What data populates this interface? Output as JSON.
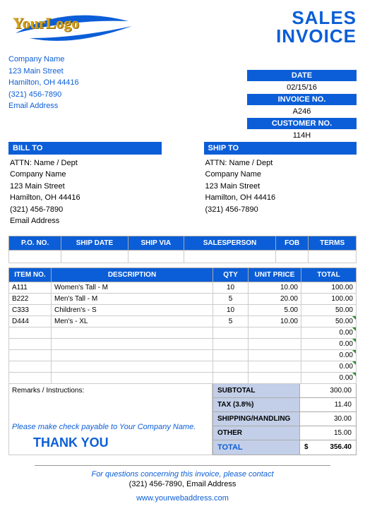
{
  "title": {
    "line1": "SALES",
    "line2": "INVOICE"
  },
  "logo": {
    "text": "YourLogo"
  },
  "company": {
    "name": "Company Name",
    "street": "123 Main Street",
    "city": "Hamilton, OH  44416",
    "phone": "(321) 456-7890",
    "email": "Email Address"
  },
  "meta": {
    "date_label": "DATE",
    "date_value": "02/15/16",
    "inv_label": "INVOICE NO.",
    "inv_value": "A246",
    "cust_label": "CUSTOMER NO.",
    "cust_value": "114H"
  },
  "bill_to": {
    "header": "BILL TO",
    "attn": "ATTN: Name / Dept",
    "name": "Company Name",
    "street": "123 Main Street",
    "city": "Hamilton, OH  44416",
    "phone": "(321) 456-7890",
    "email": "Email Address"
  },
  "ship_to": {
    "header": "SHIP TO",
    "attn": "ATTN: Name / Dept",
    "name": "Company Name",
    "street": "123 Main Street",
    "city": "Hamilton, OH  44416",
    "phone": "(321) 456-7890"
  },
  "detail_headers": [
    "P.O. NO.",
    "SHIP DATE",
    "SHIP VIA",
    "SALESPERSON",
    "FOB",
    "TERMS"
  ],
  "item_headers": [
    "ITEM NO.",
    "DESCRIPTION",
    "QTY",
    "UNIT PRICE",
    "TOTAL"
  ],
  "items": [
    {
      "no": "A111",
      "desc": "Women's Tall - M",
      "qty": "10",
      "price": "10.00",
      "total": "100.00"
    },
    {
      "no": "B222",
      "desc": "Men's Tall - M",
      "qty": "5",
      "price": "20.00",
      "total": "100.00"
    },
    {
      "no": "C333",
      "desc": "Children's - S",
      "qty": "10",
      "price": "5.00",
      "total": "50.00"
    },
    {
      "no": "D444",
      "desc": "Men's - XL",
      "qty": "5",
      "price": "10.00",
      "total": "50.00"
    }
  ],
  "empty_totals": [
    "0.00",
    "0.00",
    "0.00",
    "0.00",
    "0.00"
  ],
  "remarks_label": "Remarks / Instructions:",
  "totals": {
    "subtotal_label": "SUBTOTAL",
    "subtotal_value": "300.00",
    "tax_label": "TAX (3.8%)",
    "tax_value": "11.40",
    "shipping_label": "SHIPPING/HANDLING",
    "shipping_value": "30.00",
    "other_label": "OTHER",
    "other_value": "15.00",
    "total_label": "TOTAL",
    "total_value": "356.40",
    "currency": "$"
  },
  "note": "Please make check payable to Your Company Name.",
  "thanks": "THANK YOU",
  "footer": {
    "question": "For questions concerning this invoice, please contact",
    "contact": "(321) 456-7890, Email Address",
    "url": "www.yourwebaddress.com"
  }
}
